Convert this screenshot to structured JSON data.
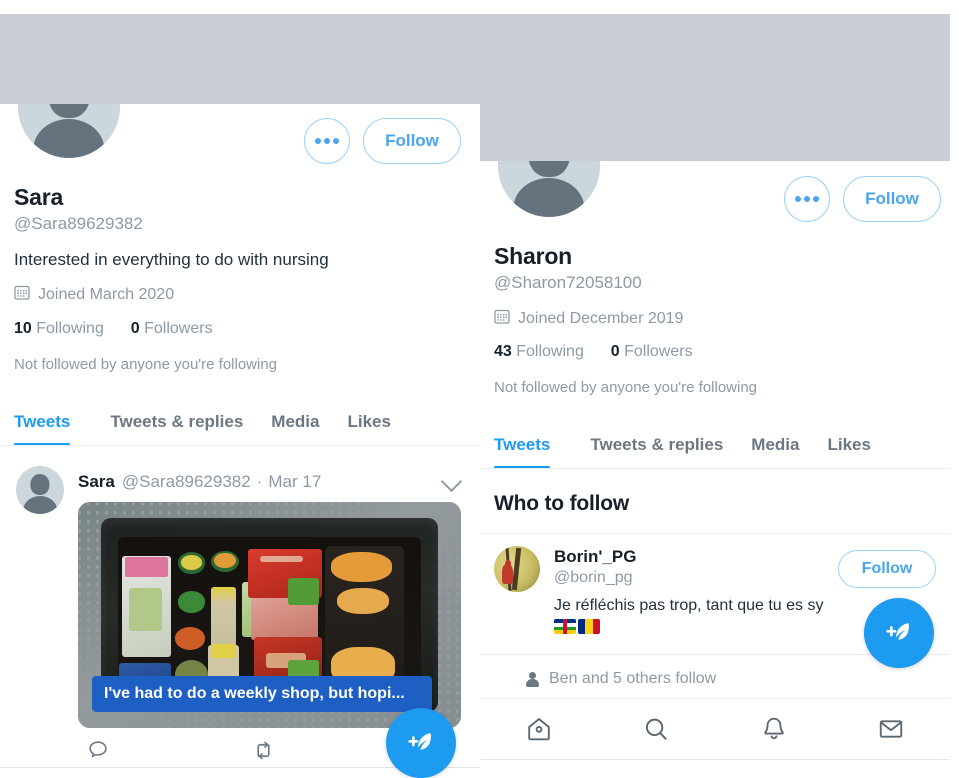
{
  "app": {
    "name": "Twitter",
    "accent_blue": "#1d9bf0",
    "light_blue": "#49a5ee",
    "banner_gray": "#c9ced6",
    "text_gray": "#8d99a5"
  },
  "left_profile": {
    "avatar_icon": "default-avatar-icon",
    "more_button_label": "",
    "more_icon": "more-dots-icon",
    "follow_button_label": "Follow",
    "display_name": "Sara",
    "handle": "@Sara89629382",
    "bio": "Interested in everything to do with nursing",
    "joined_icon": "calendar-icon",
    "joined": "Joined March 2020",
    "following_count": "10",
    "following_label": "Following",
    "followers_count": "0",
    "followers_label": "Followers",
    "not_followed_note": "Not followed by anyone you're following",
    "tabs": [
      {
        "label": "Tweets",
        "active": true
      },
      {
        "label": "Tweets & replies",
        "active": false
      },
      {
        "label": "Media",
        "active": false
      },
      {
        "label": "Likes",
        "active": false
      }
    ],
    "tweet": {
      "author_name": "Sara",
      "author_handle": "@Sara89629382",
      "separator": "·",
      "date": "Mar 17",
      "caret_icon": "chevron-down-icon",
      "media_caption": "I've had to do a weekly shop, but hopi...",
      "media_alt": "Black plastic crate filled with groceries on grey ground",
      "actions": [
        {
          "name": "reply",
          "icon": "reply-icon"
        },
        {
          "name": "retweet",
          "icon": "retweet-icon"
        },
        {
          "name": "like",
          "icon": "heart-icon"
        }
      ]
    },
    "compose_button": {
      "icon": "compose-tweet-icon",
      "label": ""
    }
  },
  "right_profile": {
    "avatar_icon": "default-avatar-icon",
    "more_icon": "more-dots-icon",
    "follow_button_label": "Follow",
    "display_name": "Sharon",
    "handle": "@Sharon72058100",
    "joined_icon": "calendar-icon",
    "joined": "Joined December 2019",
    "following_count": "43",
    "following_label": "Following",
    "followers_count": "0",
    "followers_label": "Followers",
    "not_followed_note": "Not followed by anyone you're following",
    "tabs": [
      {
        "label": "Tweets",
        "active": true
      },
      {
        "label": "Tweets & replies",
        "active": false
      },
      {
        "label": "Media",
        "active": false
      },
      {
        "label": "Likes",
        "active": false
      }
    ],
    "who_to_follow": {
      "title": "Who to follow",
      "suggestion": {
        "avatar_icon": "user-photo-avatar",
        "name": "Borin'_PG",
        "handle": "@borin_pg",
        "bio": "Je réfléchis pas trop, tant que tu es sy",
        "flags": [
          "central-african-republic-flag",
          "romania-flag"
        ],
        "follow_button_label": "Follow"
      },
      "followed_by_icon": "person-icon",
      "followed_by": "Ben and 5 others follow"
    },
    "compose_button": {
      "icon": "compose-tweet-icon",
      "label": ""
    },
    "bottom_nav": [
      {
        "name": "home",
        "icon": "home-icon"
      },
      {
        "name": "search",
        "icon": "search-icon"
      },
      {
        "name": "notifications",
        "icon": "bell-icon"
      },
      {
        "name": "messages",
        "icon": "envelope-icon"
      }
    ]
  }
}
